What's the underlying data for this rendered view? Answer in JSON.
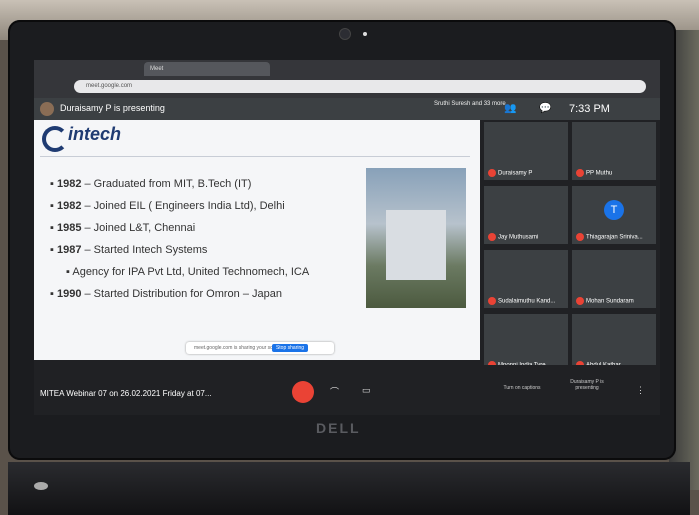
{
  "meeting": {
    "presenting_label": "Duraisamy P is presenting",
    "participants_text": "Sruthi Suresh and 33 more",
    "time": "7:33 PM",
    "meeting_title": "MITEA Webinar 07 on 26.02.2021 Friday at 07...",
    "captions_label": "Turn on captions",
    "presenting_button": "Duraisamy P is presenting",
    "share_notice": "meet.google.com is sharing your screen.",
    "stop_sharing": "Stop sharing"
  },
  "slide": {
    "logo": "intech",
    "bullets": [
      {
        "year": "1982",
        "text": " – Graduated from MIT, B.Tech (IT)"
      },
      {
        "year": "1982",
        "text": " – Joined EIL ( Engineers India Ltd), Delhi"
      },
      {
        "year": "1985",
        "text": " – Joined L&T, Chennai"
      },
      {
        "year": "1987",
        "text": " – Started Intech Systems"
      },
      {
        "year": "",
        "text": "Agency for IPA Pvt Ltd, United Technomech, ICA"
      },
      {
        "year": "1990",
        "text": " – Started Distribution for Omron – Japan"
      }
    ]
  },
  "participants": [
    "Duraisamy P",
    "PP Muthu",
    "Jay Muthusami",
    "Thiagarajan Sriniva...",
    "Sudalaimuthu Kand...",
    "Mohan Sundaram",
    "Mponni India Tyre...",
    "Abdul Kathar"
  ],
  "laptop": {
    "brand": "DELL"
  }
}
